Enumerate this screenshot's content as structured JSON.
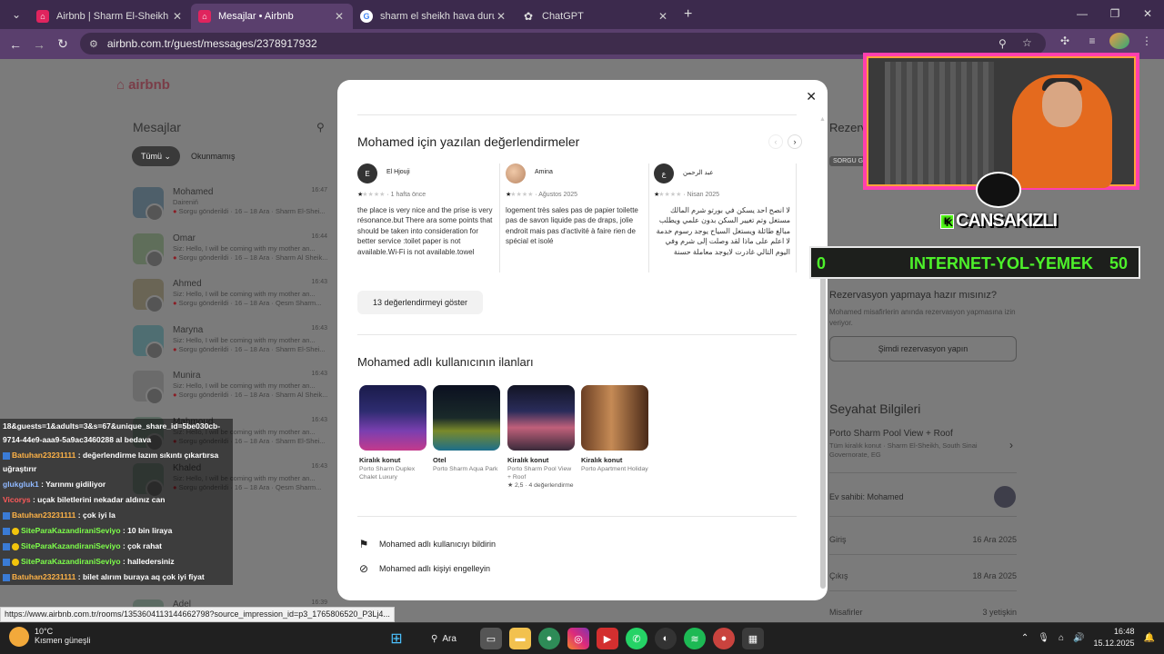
{
  "browser": {
    "tabs": [
      {
        "title": "Airbnb | Sharm El-Sheikh - Tatil",
        "color": "#e0245e"
      },
      {
        "title": "Mesajlar • Airbnb",
        "color": "#e0245e",
        "active": true
      },
      {
        "title": "sharm el sheikh hava durumu -",
        "color": "#4285f4"
      },
      {
        "title": "ChatGPT",
        "color": "#666666"
      }
    ],
    "url": "airbnb.com.tr/guest/messages/2378917932"
  },
  "sidebar": {
    "logo": "airbnb",
    "title": "Mesajlar",
    "filters": [
      "Tümü",
      "Okunmamış"
    ],
    "conversations": [
      {
        "name": "Mohamed",
        "time": "16:47",
        "preview": "Daireniň",
        "status": "Sorgu gönderildi · 16 – 18 Ara · Sharm El-Shei..."
      },
      {
        "name": "Omar",
        "time": "16:44",
        "preview": "Siz: Hello, I will be coming with my mother an...",
        "status": "Sorgu gönderildi · 16 – 18 Ara · Sharm Al Sheik..."
      },
      {
        "name": "Ahmed",
        "time": "16:43",
        "preview": "Siz: Hello, I will be coming with my mother an...",
        "status": "Sorgu gönderildi · 16 – 18 Ara · Qesm Sharm..."
      },
      {
        "name": "Maryna",
        "time": "16:43",
        "preview": "Siz: Hello, I will be coming with my mother an...",
        "status": "Sorgu gönderildi · 16 – 18 Ara · Sharm El-Shei..."
      },
      {
        "name": "Munira",
        "time": "16:43",
        "preview": "Siz: Hello, I will be coming with my mother an...",
        "status": "Sorgu gönderildi · 16 – 18 Ara · Sharm Al Sheik..."
      },
      {
        "name": "Mahmoud",
        "time": "16:43",
        "preview": "Siz: Hello, I will be coming with my mother an...",
        "status": "Sorgu gönderildi · 16 – 18 Ara · Sharm El-Shei..."
      },
      {
        "name": "Khaled",
        "time": "16:43",
        "preview": "Siz: Hello, I will be coming with my mother an...",
        "status": "Sorgu gönderildi · 16 – 18 Ara · Qesm Sharm..."
      },
      {
        "name": "Adel",
        "time": "16:39",
        "preview": "",
        "status": ""
      }
    ]
  },
  "modal": {
    "reviews_title": "Mohamed için yazılan değerlendirmeler",
    "reviews": [
      {
        "initial": "E",
        "name": "El Hjouji",
        "date": "1 hafta önce",
        "text": "the place is very nice and the prise is very résonance.but There ara some points that should be taken into consideration for better service :toilet paper is not available.Wi-Fi is not available.towel convers are not available.and the dishes..."
      },
      {
        "initial": "",
        "name": "Amina",
        "date": "Ağustos 2025",
        "text": "logement très sales pas de papier toilette pas de savon liquide pas de draps, jolie endroit mais pas d'activité à faire rien de spécial et isolé"
      },
      {
        "initial": "ع",
        "name": "عبد الرحمن",
        "date": "Nisan 2025",
        "text": "لا انصح احد يسكن في بورتو شرم المالك مستغل وتم تغيير السكن بدون علمي ويطلب مبالغ طائلة ويستغل السياح يوجد رسوم خدمة لا اعلم على ماذا لقد وصلت إلى شرم وفي اليوم التالي غادرت لايوجد معاملة حسنة الشخص مخادع سارق لعين وكاذب لا انصح يتعامل معه لا"
      }
    ],
    "stars": "★",
    "show_reviews": "13 değerlendirmeyi göster",
    "listings_title": "Mohamed adlı kullanıcının ilanları",
    "listings": [
      {
        "type": "Kiralık konut",
        "name": "Porto Sharm Duplex Chalet Luxury",
        "rating": ""
      },
      {
        "type": "Otel",
        "name": "Porto Sharm Aqua Park",
        "rating": ""
      },
      {
        "type": "Kiralık konut",
        "name": "Porto Sharm Pool View + Roof",
        "rating": "★ 2,5 · 4 değerlendirme"
      },
      {
        "type": "Kiralık konut",
        "name": "Porto Apartment Holiday",
        "rating": ""
      }
    ],
    "report": "Mohamed adlı kullanıcıyı bildirin",
    "block": "Mohamed adlı kişiyi engelleyin"
  },
  "right_panel": {
    "partial_title": "Rezerva",
    "partial_badge": "SORGU G",
    "ready_title": "Rezervasyon yapmaya hazır mısınız?",
    "ready_text_1": "Mohamed misafirlerin anında rezervasyon yapmasına izin",
    "ready_text_2": "veriyor.",
    "book_button": "Şimdi rezervasyon yapın",
    "travel_title": "Seyahat Bilgileri",
    "listing_name": "Porto Sharm Pool View + Roof",
    "listing_sub_1": "Tüm kiralık konut · Sharm El-Sheikh, South Sinai",
    "listing_sub_2": "Governorate, EG",
    "host": "Ev sahibi: Mohamed",
    "checkin_label": "Giriş",
    "checkin_value": "16 Ara 2025",
    "checkout_label": "Çıkış",
    "checkout_value": "18 Ara 2025",
    "guests_label": "Misafirler",
    "guests_value": "3 yetişkin"
  },
  "overlay": {
    "streamer": "CANSAKIZLI",
    "goal_left": "0",
    "goal_label": "INTERNET-YOL-YEMEK",
    "goal_right": "50",
    "chat_head_1": "18&guests=1&adults=3&s=67&unique_share_id=5be030cb-",
    "chat_head_2": "9714-44e9-aaa9-5a9ac3460288 al bedava",
    "chat": [
      {
        "user": "Batuhan23231111",
        "msg": ": değerlendirme lazım sıkıntı çıkartırsa uğraştırır",
        "cls": "u1"
      },
      {
        "user": "glukgluk1",
        "msg": ": Yarınmı gidiliyor",
        "cls": "u2"
      },
      {
        "user": "Vicorys",
        "msg": ": uçak biletlerini nekadar aldınız can",
        "cls": "u3"
      },
      {
        "user": "Batuhan23231111",
        "msg": ": çok iyi la",
        "cls": "u1"
      },
      {
        "user": "SiteParaKazandiraniSeviyo",
        "msg": ": 10 bin liraya",
        "cls": "u4"
      },
      {
        "user": "SiteParaKazandiraniSeviyo",
        "msg": ": çok rahat",
        "cls": "u4"
      },
      {
        "user": "SiteParaKazandiraniSeviyo",
        "msg": ": halledersiniz",
        "cls": "u4"
      },
      {
        "user": "Batuhan23231111",
        "msg": ": bilet alırım buraya aq çok iyi fiyat",
        "cls": "u1"
      }
    ]
  },
  "status_url": "https://www.airbnb.com.tr/rooms/1353604113144662798?source_impression_id=p3_1765806520_P3Lj4...",
  "taskbar": {
    "temp": "10°C",
    "weather": "Kısmen güneşli",
    "search": "Ara",
    "time": "16:48",
    "date": "15.12.2025"
  }
}
